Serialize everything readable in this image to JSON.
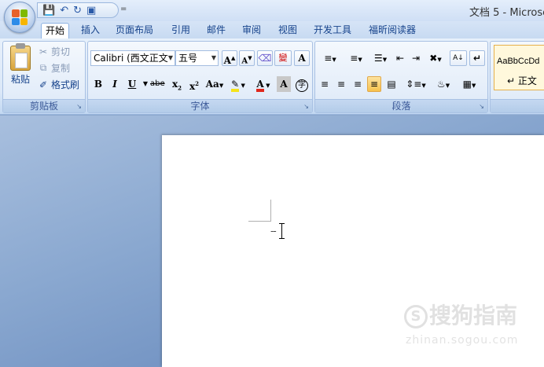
{
  "window": {
    "title": "文档 5 - Microsc"
  },
  "qat": {
    "save_icon": "save-icon",
    "undo_icon": "undo-icon",
    "redo_icon": "redo-icon",
    "print_icon": "print-icon",
    "more": "="
  },
  "tabs": [
    {
      "label": "开始",
      "active": true
    },
    {
      "label": "插入"
    },
    {
      "label": "页面布局"
    },
    {
      "label": "引用"
    },
    {
      "label": "邮件"
    },
    {
      "label": "审阅"
    },
    {
      "label": "视图"
    },
    {
      "label": "开发工具"
    },
    {
      "label": "福昕阅读器"
    }
  ],
  "clipboard": {
    "paste": "粘贴",
    "cut": "剪切",
    "copy": "复制",
    "format_painter": "格式刷",
    "group_label": "剪贴板"
  },
  "font": {
    "font_name": "Calibri (西文正文",
    "font_size": "五号",
    "group_label": "字体",
    "grow": "A",
    "shrink": "A",
    "bold": "B",
    "italic": "I",
    "underline": "U",
    "strike": "abe",
    "subscript": "x",
    "superscript": "x",
    "change_case": "Aa",
    "font_color": "A",
    "char_shading": "A",
    "wen": "變",
    "enclose": "字",
    "highlight_color": "#f5e31b",
    "font_color_value": "#e0271c"
  },
  "paragraph": {
    "group_label": "段落",
    "sort": "A↓",
    "show_marks": "↵"
  },
  "styles": {
    "preview": "AaBbCcDd",
    "name": "↵ 正文"
  },
  "watermark": {
    "text": "搜狗指南",
    "sub": "zhinan.sogou.com"
  }
}
